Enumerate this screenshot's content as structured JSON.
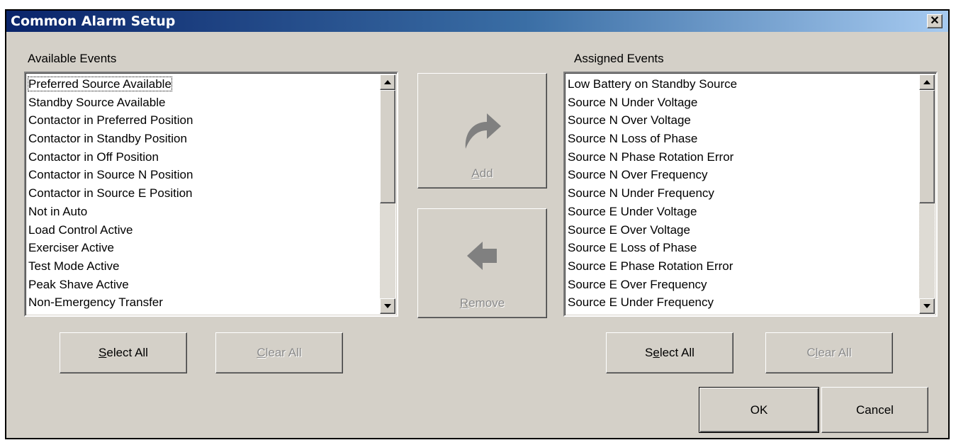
{
  "window": {
    "title": "Common Alarm Setup",
    "close_glyph": "✕"
  },
  "available": {
    "label": "Available Events",
    "items": [
      "Preferred Source Available",
      "Standby Source Available",
      "Contactor in Preferred Position",
      "Contactor in Standby Position",
      "Contactor in Off Position",
      "Contactor in Source N  Position",
      "Contactor in Source E  Position",
      "Not in Auto",
      "Load Control Active",
      "Exerciser Active",
      "Test Mode Active",
      "Peak Shave Active",
      "Non-Emergency Transfer"
    ],
    "select_all": {
      "pre": "",
      "key": "S",
      "post": "elect All"
    },
    "clear_all": {
      "pre": "",
      "key": "C",
      "post": "lear All"
    }
  },
  "assigned": {
    "label": "Assigned Events",
    "items": [
      "Low Battery on Standby Source",
      "Source N Under Voltage",
      "Source N Over Voltage",
      "Source N Loss of Phase",
      "Source N Phase Rotation Error",
      "Source N Over Frequency",
      "Source N Under Frequency",
      "Source E Under Voltage",
      "Source E Over Voltage",
      "Source E Loss of Phase",
      "Source E Phase Rotation Error",
      "Source E Over Frequency",
      "Source E Under Frequency"
    ],
    "select_all": {
      "pre": "S",
      "key": "e",
      "post": "lect All"
    },
    "clear_all": {
      "pre": "C",
      "key": "l",
      "post": "ear All"
    }
  },
  "add_button": {
    "pre": "",
    "key": "A",
    "post": "dd",
    "icon": "arrow-curve-right-icon"
  },
  "remove_button": {
    "pre": "",
    "key": "R",
    "post": "emove",
    "icon": "arrow-left-icon"
  },
  "ok_label": "OK",
  "cancel_label": "Cancel",
  "colors": {
    "title_start": "#0a246a",
    "title_end": "#a6caf0",
    "dialog_bg": "#d4d0c8",
    "disabled_text": "#8a8a8a",
    "icon_gray": "#808080"
  }
}
